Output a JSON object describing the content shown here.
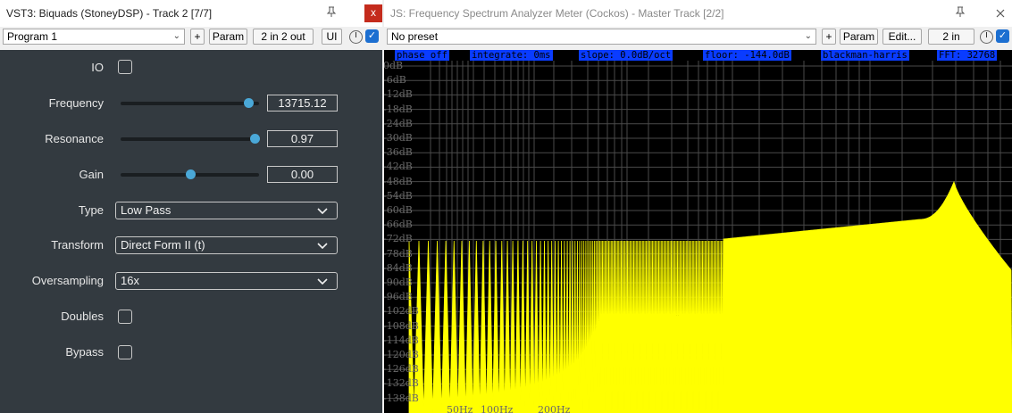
{
  "left_window": {
    "title": "VST3: Biquads (StoneyDSP) - Track 2 [7/7]",
    "close_glyph": "x",
    "preset": "Program 1",
    "add_label": "+",
    "param_label": "Param",
    "io_label": "2 in 2 out",
    "ui_label": "UI",
    "enabled_glyph": "✓"
  },
  "plugin": {
    "io_label": "IO",
    "frequency": {
      "label": "Frequency",
      "value": "13715.12",
      "slider_fraction": 0.92
    },
    "resonance": {
      "label": "Resonance",
      "value": "0.97",
      "slider_fraction": 0.97
    },
    "gain": {
      "label": "Gain",
      "value": "0.00",
      "slider_fraction": 0.5
    },
    "type": {
      "label": "Type",
      "value": "Low Pass"
    },
    "transform": {
      "label": "Transform",
      "value": "Direct Form II (t)"
    },
    "oversampling": {
      "label": "Oversampling",
      "value": "16x"
    },
    "doubles_label": "Doubles",
    "bypass_label": "Bypass",
    "accent_color": "#4aa8d8",
    "panel_color": "#333a40"
  },
  "right_window": {
    "title": "JS: Frequency Spectrum Analyzer Meter (Cockos) - Master Track [2/2]",
    "preset": "No preset",
    "add_label": "+",
    "param_label": "Param",
    "edit_label": "Edit...",
    "io_label": "2 in",
    "enabled_glyph": "✓"
  },
  "analyzer": {
    "info": [
      "phase off",
      "integrate: 0ms",
      "slope: 0.0dB/oct",
      "floor: -144.0dB",
      "blackman-harris",
      "FFT: 32768"
    ],
    "db_labels": [
      "0dB",
      "-6dB",
      "-12dB",
      "-18dB",
      "-24dB",
      "-30dB",
      "-36dB",
      "-42dB",
      "-48dB",
      "-54dB",
      "-60dB",
      "-66dB",
      "-72dB",
      "-78dB",
      "-84dB",
      "-90dB",
      "-96dB",
      "-102dB",
      "-108dB",
      "-114dB",
      "-120dB",
      "-126dB",
      "-132dB",
      "-138dB"
    ],
    "hz_labels": [
      "50Hz",
      "100Hz",
      "200Hz"
    ],
    "spectrum_color": "#ffff00",
    "info_color": "#0a3cff"
  }
}
